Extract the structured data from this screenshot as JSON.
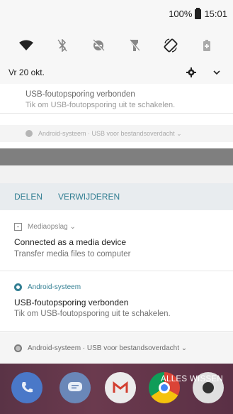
{
  "status": {
    "battery": "100%",
    "time": "15:01"
  },
  "quick_settings": {
    "icons": [
      "wifi-icon",
      "bluetooth-off-icon",
      "dnd-off-icon",
      "flashlight-off-icon",
      "auto-rotate-icon",
      "battery-saver-icon"
    ]
  },
  "date_row": {
    "date": "Vr 20 okt."
  },
  "card_top": {
    "title": "USB-foutopsporing verbonden",
    "text": "Tik om USB-foutopsporing uit te schakelen."
  },
  "card_collapsed": {
    "text": "Android-systeem · USB voor bestandsoverdacht ⌄"
  },
  "actions": {
    "share": "DELEN",
    "delete": "VERWIJDEREN"
  },
  "media_notification": {
    "app": "Mediaopslag ⌄",
    "title": "Connected as a media device",
    "text": "Transfer media files to computer"
  },
  "usb_notification": {
    "app": "Android-systeem",
    "title": "USB-foutopsporing verbonden",
    "text": "Tik om USB-foutopsporing uit te schakelen."
  },
  "summary": {
    "text": "Android-systeem · USB voor bestandsoverdacht ⌄"
  },
  "clear_all": "ALLES WISSEN",
  "colors": {
    "accent": "#337f93",
    "wallpaper": "#5a3346"
  }
}
